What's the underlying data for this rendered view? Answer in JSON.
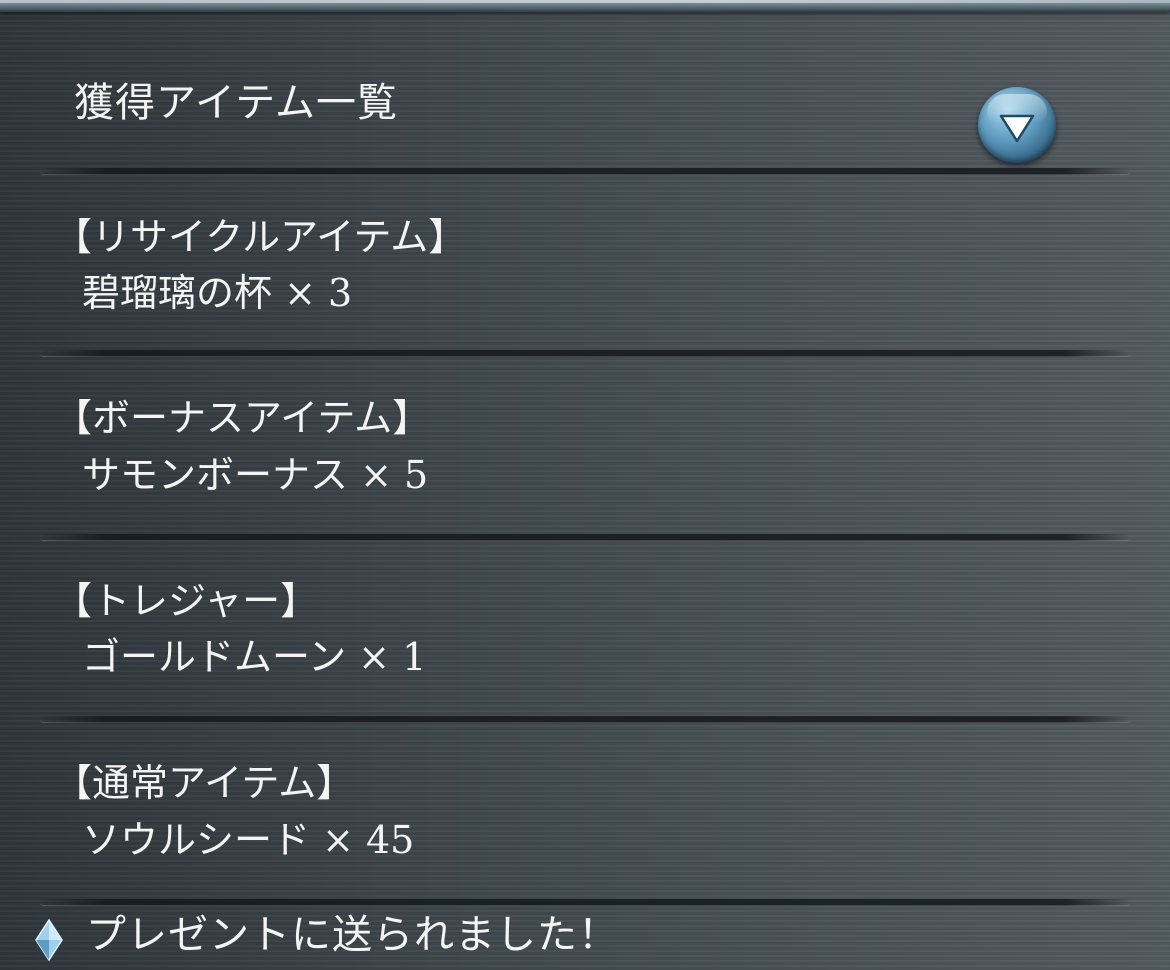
{
  "header": {
    "title": "獲得アイテム一覧",
    "collapse_icon": "chevron-down-icon"
  },
  "sections": [
    {
      "heading": "【リサイクルアイテム】",
      "item": "碧瑠璃の杯 × 3"
    },
    {
      "heading": "【ボーナスアイテム】",
      "item": "サモンボーナス × 5"
    },
    {
      "heading": "【トレジャー】",
      "item": "ゴールドムーン × 1"
    },
    {
      "heading": "【通常アイテム】",
      "item": "ソウルシード × 45"
    }
  ],
  "footer": {
    "icon": "crystal-icon",
    "message": "プレゼントに送られました！"
  },
  "colors": {
    "panel_background": "#444c51",
    "text": "#f4f4f2",
    "button_accent": "#5f9cbf"
  }
}
